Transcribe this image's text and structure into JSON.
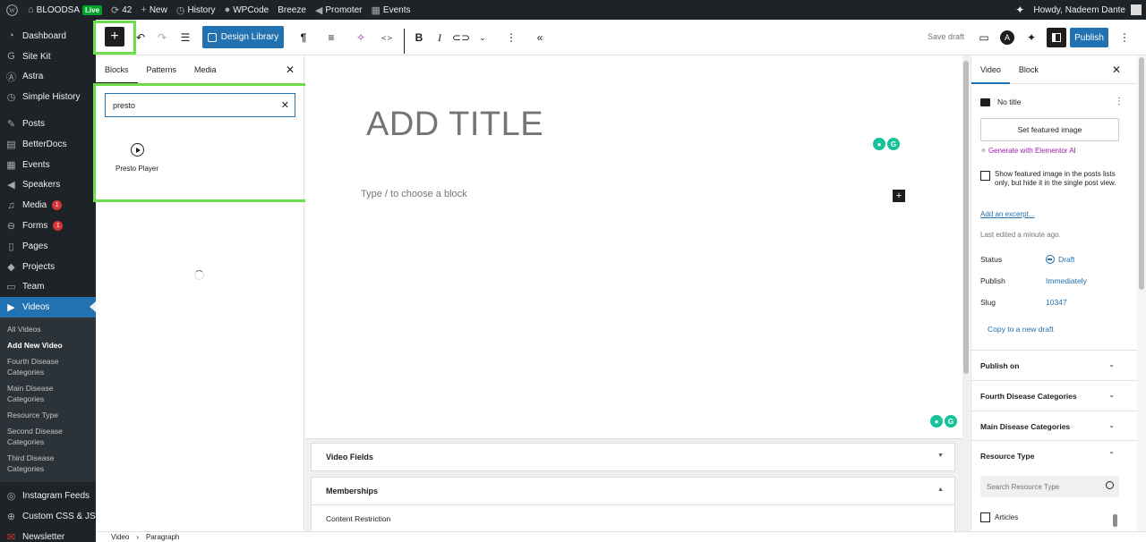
{
  "admin_bar": {
    "site_name": "BLOODSA",
    "live_label": "Live",
    "updates_count": "42",
    "new_label": "New",
    "history_label": "History",
    "wpcode_label": "WPCode",
    "breeze_label": "Breeze",
    "promoter_label": "Promoter",
    "events_label": "Events",
    "howdy": "Howdy, Nadeem Dante"
  },
  "sidebar": {
    "items": [
      {
        "label": "Dashboard",
        "icon": "dashboard-icon"
      },
      {
        "label": "Site Kit",
        "icon": "sitekit-icon"
      },
      {
        "label": "Astra",
        "icon": "astra-icon"
      },
      {
        "label": "Simple History",
        "icon": "history-icon"
      },
      {
        "label": "Posts",
        "icon": "pin-icon"
      },
      {
        "label": "BetterDocs",
        "icon": "docs-icon"
      },
      {
        "label": "Events",
        "icon": "calendar-icon"
      },
      {
        "label": "Speakers",
        "icon": "megaphone-icon"
      },
      {
        "label": "Media",
        "icon": "media-icon",
        "badge": "1"
      },
      {
        "label": "Forms",
        "icon": "forms-icon",
        "badge": "1"
      },
      {
        "label": "Pages",
        "icon": "pages-icon"
      },
      {
        "label": "Projects",
        "icon": "tag-icon"
      },
      {
        "label": "Team",
        "icon": "team-icon"
      },
      {
        "label": "Videos",
        "icon": "video-icon"
      }
    ],
    "submenu": [
      "All Videos",
      "Add New Video",
      "Fourth Disease Categories",
      "Main Disease Categories",
      "Resource Type",
      "Second Disease Categories",
      "Third Disease Categories"
    ],
    "bottom_items": [
      {
        "label": "Instagram Feeds",
        "icon": "instagram-icon"
      },
      {
        "label": "Custom CSS & JS",
        "icon": "plus-circle-icon"
      },
      {
        "label": "Newsletter",
        "icon": "mail-icon"
      }
    ]
  },
  "toolbar": {
    "design_library": "Design Library",
    "save_draft": "Save draft",
    "publish": "Publish"
  },
  "inserter": {
    "tabs": [
      "Blocks",
      "Patterns",
      "Media"
    ],
    "search_value": "presto",
    "result_label": "Presto Player"
  },
  "canvas": {
    "title_placeholder": "ADD TITLE",
    "block_placeholder": "Type / to choose a block"
  },
  "metaboxes": {
    "video_fields": "Video Fields",
    "memberships": "Memberships",
    "content_restriction": "Content Restriction"
  },
  "settings": {
    "tabs": [
      "Video",
      "Block"
    ],
    "doc_title": "No title",
    "set_featured": "Set featured image",
    "gen_ai": "Generate with Elementor AI",
    "featured_checkbox": "Show featured image in the posts lists only, but hide it in the single post view.",
    "add_excerpt": "Add an excerpt...",
    "last_edited": "Last edited a minute ago.",
    "status_label": "Status",
    "status_value": "Draft",
    "publish_label": "Publish",
    "publish_value": "Immediately",
    "slug_label": "Slug",
    "slug_value": "10347",
    "copy_draft": "Copy to a new draft",
    "panels": [
      "Publish on",
      "Fourth Disease Categories",
      "Main Disease Categories",
      "Resource Type"
    ],
    "resource_search_placeholder": "Search Resource Type",
    "resource_option": "Articles"
  },
  "footer": {
    "breadcrumb": [
      "Video",
      "Paragraph"
    ]
  }
}
